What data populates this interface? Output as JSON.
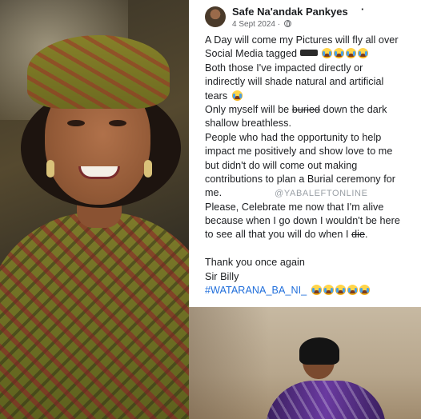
{
  "post": {
    "author": "Safe Na'andak Pankyes",
    "more_symbol": "·",
    "date": "4 Sept 2024",
    "date_separator": "·",
    "visibility_icon": "globe-icon",
    "emoji_icon": "loudly-crying-face",
    "lines": {
      "l1": "A Day will come my Pictures will fly all over",
      "l2": "Social Media tagged",
      "l3": "Both those I've impacted directly or",
      "l4": "indirectly will shade natural and artificial",
      "l5": "tears",
      "l6_a": "Only myself will be",
      "l6_b": "buried",
      "l6_c": "down the dark",
      "l7": "shallow breathless.",
      "l8": "People who had the opportunity to help",
      "l9": "impact me positively and show love to me",
      "l10": "but didn't do will come out making",
      "l11": "contributions to plan a Burial ceremony for",
      "l12": "me.",
      "l13": "Please, Celebrate me now that I'm alive",
      "l14": "because when I go down I wouldn't be here",
      "l15_a": "to see all that you will do when I",
      "l15_b": "die",
      "l15_c": ".",
      "l16": "Thank you once again",
      "l17": "Sir Billy",
      "hashtag": "#WATARANA_BA_NI_"
    },
    "watermark": "@YABALEFTONLINE"
  }
}
